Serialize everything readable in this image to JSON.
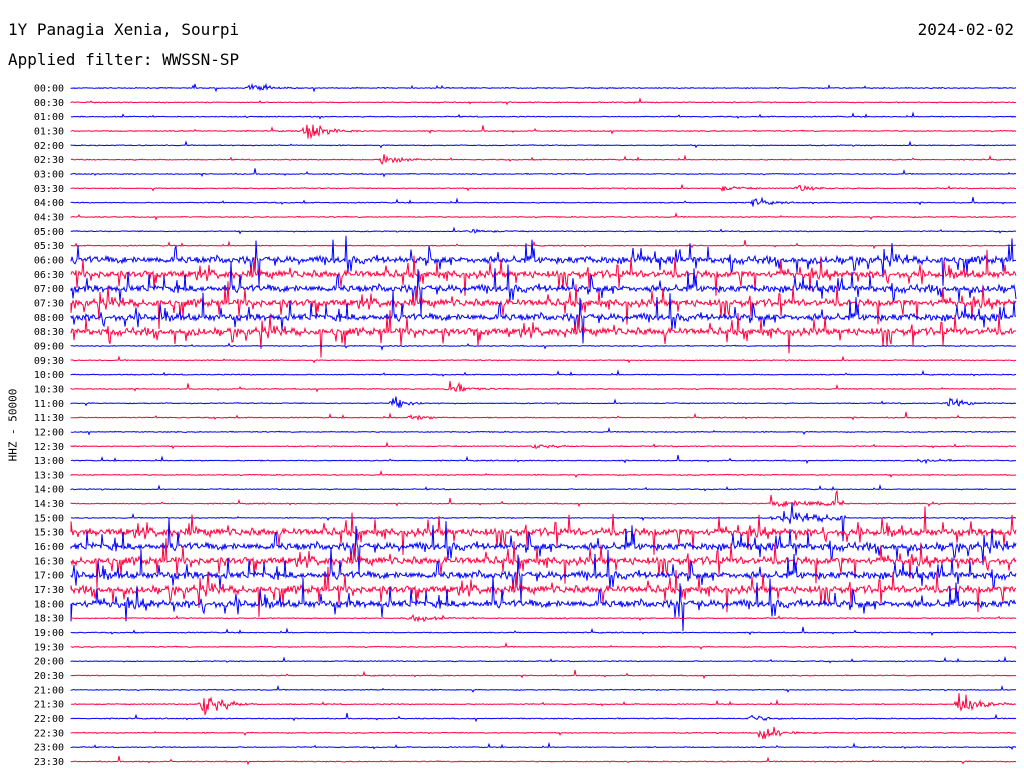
{
  "header": {
    "station": "1Y Panagia Xenia, Sourpi",
    "date": "2024-02-02",
    "filter": "Applied filter: WWSSN-SP"
  },
  "chart_data": {
    "type": "line",
    "title": "1Y Panagia Xenia, Sourpi",
    "ylabel": "HHZ - 50000",
    "tick_labels": [
      "00:00",
      "00:30",
      "01:00",
      "01:30",
      "02:00",
      "02:30",
      "03:00",
      "03:30",
      "04:00",
      "04:30",
      "05:00",
      "05:30",
      "06:00",
      "06:30",
      "07:00",
      "07:30",
      "08:00",
      "08:30",
      "09:00",
      "09:30",
      "10:00",
      "10:30",
      "11:00",
      "11:30",
      "12:00",
      "12:30",
      "13:00",
      "13:30",
      "14:00",
      "14:30",
      "15:00",
      "15:30",
      "16:00",
      "16:30",
      "17:00",
      "17:30",
      "18:00",
      "18:30",
      "19:00",
      "19:30",
      "20:00",
      "20:30",
      "21:00",
      "21:30",
      "22:00",
      "22:30",
      "23:00",
      "23:30"
    ],
    "colors": [
      "#0000ff",
      "#ff0040"
    ],
    "grid": false,
    "events": [
      {
        "row": 0,
        "x": 0.19,
        "amp": 8
      },
      {
        "row": 3,
        "x": 0.25,
        "amp": 18
      },
      {
        "row": 5,
        "x": 0.33,
        "amp": 14
      },
      {
        "row": 7,
        "x": 0.69,
        "amp": 4
      },
      {
        "row": 7,
        "x": 0.77,
        "amp": 5
      },
      {
        "row": 8,
        "x": 0.72,
        "amp": 6
      },
      {
        "row": 10,
        "x": 0.42,
        "amp": 4
      },
      {
        "row": 21,
        "x": 0.4,
        "amp": 12
      },
      {
        "row": 22,
        "x": 0.34,
        "amp": 10
      },
      {
        "row": 22,
        "x": 0.93,
        "amp": 8
      },
      {
        "row": 23,
        "x": 0.36,
        "amp": 5
      },
      {
        "row": 25,
        "x": 0.49,
        "amp": 5
      },
      {
        "row": 26,
        "x": 0.9,
        "amp": 5
      },
      {
        "row": 37,
        "x": 0.36,
        "amp": 8
      },
      {
        "row": 43,
        "x": 0.14,
        "amp": 28
      },
      {
        "row": 43,
        "x": 0.94,
        "amp": 22
      },
      {
        "row": 44,
        "x": 0.72,
        "amp": 6
      },
      {
        "row": 45,
        "x": 0.73,
        "amp": 16
      }
    ],
    "noisy_windows": [
      {
        "rows": [
          12,
          17
        ],
        "x_start": 0.0,
        "x_end": 1.0,
        "amp": 38
      },
      {
        "rows": [
          29,
          30
        ],
        "x_start": 0.74,
        "x_end": 0.82,
        "amp": 34
      },
      {
        "rows": [
          31,
          36
        ],
        "x_start": 0.0,
        "x_end": 1.0,
        "amp": 40
      }
    ]
  }
}
